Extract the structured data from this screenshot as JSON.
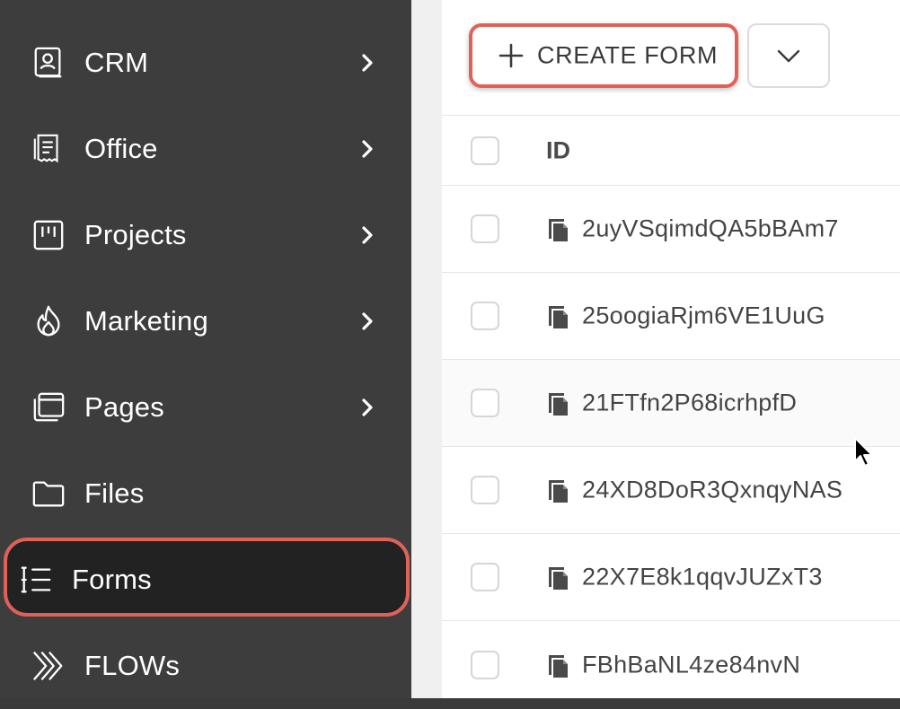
{
  "sidebar": {
    "items": [
      {
        "label": "CRM",
        "icon": "contact-book-icon",
        "has_chevron": true
      },
      {
        "label": "Office",
        "icon": "receipt-icon",
        "has_chevron": true
      },
      {
        "label": "Projects",
        "icon": "kanban-board-icon",
        "has_chevron": true
      },
      {
        "label": "Marketing",
        "icon": "flame-icon",
        "has_chevron": true
      },
      {
        "label": "Pages",
        "icon": "browser-windows-icon",
        "has_chevron": true
      },
      {
        "label": "Files",
        "icon": "folder-icon",
        "has_chevron": false
      },
      {
        "label": "Forms",
        "icon": "form-list-icon",
        "has_chevron": false,
        "active": true
      },
      {
        "label": "FLOWs",
        "icon": "double-chevron-icon",
        "has_chevron": false
      }
    ]
  },
  "toolbar": {
    "create_label": "CREATE FORM"
  },
  "table": {
    "columns": [
      "ID"
    ],
    "rows": [
      {
        "id": "2uyVSqimdQA5bBAm7"
      },
      {
        "id": "25oogiaRjm6VE1UuG"
      },
      {
        "id": "21FTfn2P68icrhpfD"
      },
      {
        "id": "24XD8DoR3QxnqyNAS"
      },
      {
        "id": "22X7E8k1qqvJUZxT3"
      },
      {
        "id": "FBhBaNL4ze84nvN"
      }
    ]
  },
  "colors": {
    "sidebar_bg": "#3d3d3d",
    "active_bg": "#1f1f1f",
    "highlight": "#e06157",
    "text_light": "#ffffff",
    "text_dark": "#444444"
  }
}
